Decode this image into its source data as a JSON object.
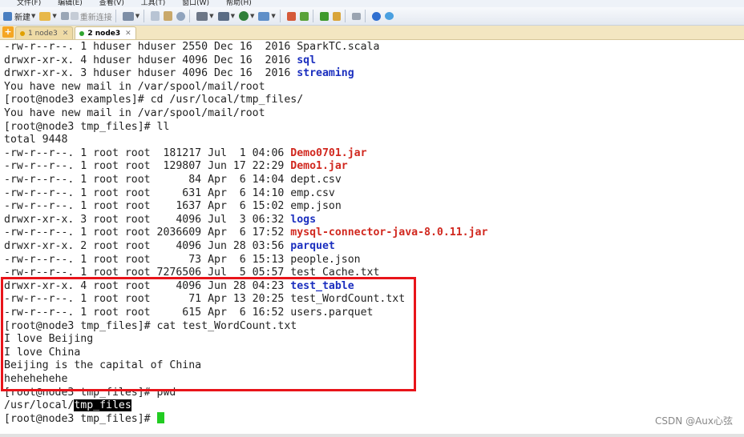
{
  "menubar": {
    "items": [
      "文件(F)",
      "编辑(E)",
      "查看(V)",
      "工具(T)",
      "窗口(W)",
      "帮助(H)"
    ]
  },
  "toolbar": {
    "new_label": "新建",
    "reconnect_label": "重新连接"
  },
  "tabs": [
    {
      "label": "1 node3",
      "active": false,
      "dot_color": "#e0a000"
    },
    {
      "label": "2 node3",
      "active": true,
      "dot_color": "#2fa52f"
    }
  ],
  "terminal": {
    "lines": [
      {
        "segments": [
          {
            "t": "-rw-r--r--. 1 hduser hduser 2550 Dec 16  2016 SparkTC.scala"
          }
        ]
      },
      {
        "segments": [
          {
            "t": "drwxr-xr-x. 4 hduser hduser 4096 Dec 16  2016 "
          },
          {
            "t": "sql",
            "c": "blue"
          }
        ]
      },
      {
        "segments": [
          {
            "t": "drwxr-xr-x. 3 hduser hduser 4096 Dec 16  2016 "
          },
          {
            "t": "streaming",
            "c": "blue"
          }
        ]
      },
      {
        "segments": [
          {
            "t": "You have new mail in /var/spool/mail/root"
          }
        ]
      },
      {
        "segments": [
          {
            "t": "[root@node3 examples]# cd /usr/local/tmp_files/"
          }
        ]
      },
      {
        "segments": [
          {
            "t": "You have new mail in /var/spool/mail/root"
          }
        ]
      },
      {
        "segments": [
          {
            "t": "[root@node3 tmp_files]# ll"
          }
        ]
      },
      {
        "segments": [
          {
            "t": "total 9448"
          }
        ]
      },
      {
        "segments": [
          {
            "t": "-rw-r--r--. 1 root root  181217 Jul  1 04:06 "
          },
          {
            "t": "Demo0701.jar",
            "c": "red"
          }
        ]
      },
      {
        "segments": [
          {
            "t": "-rw-r--r--. 1 root root  129807 Jun 17 22:29 "
          },
          {
            "t": "Demo1.jar",
            "c": "red"
          }
        ]
      },
      {
        "segments": [
          {
            "t": "-rw-r--r--. 1 root root      84 Apr  6 14:04 dept.csv"
          }
        ]
      },
      {
        "segments": [
          {
            "t": "-rw-r--r--. 1 root root     631 Apr  6 14:10 emp.csv"
          }
        ]
      },
      {
        "segments": [
          {
            "t": "-rw-r--r--. 1 root root    1637 Apr  6 15:02 emp.json"
          }
        ]
      },
      {
        "segments": [
          {
            "t": "drwxr-xr-x. 3 root root    4096 Jul  3 06:32 "
          },
          {
            "t": "logs",
            "c": "blue"
          }
        ]
      },
      {
        "segments": [
          {
            "t": "-rw-r--r--. 1 root root 2036609 Apr  6 17:52 "
          },
          {
            "t": "mysql-connector-java-8.0.11.jar",
            "c": "red"
          }
        ]
      },
      {
        "segments": [
          {
            "t": "drwxr-xr-x. 2 root root    4096 Jun 28 03:56 "
          },
          {
            "t": "parquet",
            "c": "blue"
          }
        ]
      },
      {
        "segments": [
          {
            "t": "-rw-r--r--. 1 root root      73 Apr  6 15:13 people.json"
          }
        ]
      },
      {
        "segments": [
          {
            "t": "-rw-r--r--. 1 root root 7276506 Jul  5 05:57 test_Cache.txt"
          }
        ]
      },
      {
        "segments": [
          {
            "t": "drwxr-xr-x. 4 root root    4096 Jun 28 04:23 "
          },
          {
            "t": "test_table",
            "c": "blue"
          }
        ]
      },
      {
        "segments": [
          {
            "t": "-rw-r--r--. 1 root root      71 Apr 13 20:25 test_WordCount.txt"
          }
        ]
      },
      {
        "segments": [
          {
            "t": "-rw-r--r--. 1 root root     615 Apr  6 16:52 users.parquet"
          }
        ]
      },
      {
        "segments": [
          {
            "t": "[root@node3 tmp_files]# cat test_WordCount.txt"
          }
        ]
      },
      {
        "segments": [
          {
            "t": "I love Beijing"
          }
        ]
      },
      {
        "segments": [
          {
            "t": "I love China"
          }
        ]
      },
      {
        "segments": [
          {
            "t": "Beijing is the capital of China"
          }
        ]
      },
      {
        "segments": [
          {
            "t": "hehehehehe"
          }
        ]
      },
      {
        "segments": [
          {
            "t": "[root@node3 tmp_files]# pwd"
          }
        ]
      },
      {
        "segments": [
          {
            "t": "/usr/local/"
          },
          {
            "t": "tmp_files",
            "c": "hl"
          }
        ]
      },
      {
        "segments": [
          {
            "t": "[root@node3 tmp_files]# "
          }
        ],
        "cursor": true
      }
    ]
  },
  "watermark": "CSDN @Aux心弦"
}
